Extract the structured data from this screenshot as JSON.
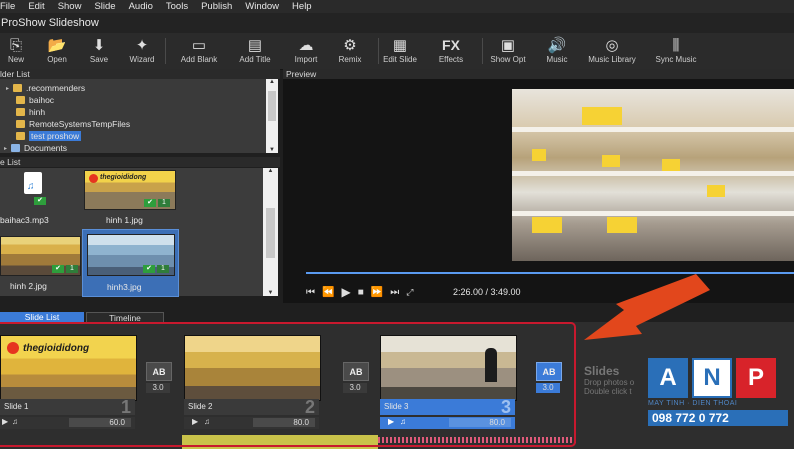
{
  "menu": [
    "File",
    "Edit",
    "Show",
    "Slide",
    "Audio",
    "Tools",
    "Publish",
    "Window",
    "Help"
  ],
  "app_title": "ProShow Slideshow",
  "toolbar": [
    {
      "label": "New",
      "icon": "new-icon"
    },
    {
      "label": "Open",
      "icon": "open-folder-icon"
    },
    {
      "label": "Save",
      "icon": "save-icon"
    },
    {
      "label": "Wizard",
      "icon": "wizard-icon"
    },
    {
      "label": "Add Blank",
      "icon": "add-blank-icon"
    },
    {
      "label": "Add Title",
      "icon": "add-title-icon"
    },
    {
      "label": "Import",
      "icon": "import-icon"
    },
    {
      "label": "Remix",
      "icon": "remix-icon"
    },
    {
      "label": "Edit Slide",
      "icon": "edit-slide-icon"
    },
    {
      "label": "Effects",
      "icon": "fx-icon"
    },
    {
      "label": "Show Opt",
      "icon": "show-options-icon"
    },
    {
      "label": "Music",
      "icon": "music-icon"
    },
    {
      "label": "Music Library",
      "icon": "music-library-icon"
    },
    {
      "label": "Sync Music",
      "icon": "sync-music-icon"
    }
  ],
  "fx_glyph": "FX",
  "folder_list": {
    "header": "lder List",
    "items": [
      ".recommenders",
      "baihoc",
      "hinh",
      "RemoteSystemsTempFiles",
      "test proshow"
    ],
    "selected_index": 4,
    "documents": "Documents"
  },
  "file_list": {
    "header": "e List",
    "files": [
      {
        "name": "baihac3.mp3"
      },
      {
        "name": "hinh 1.jpg"
      },
      {
        "name": "hinh 2.jpg"
      },
      {
        "name": "hinh3.jpg"
      }
    ],
    "check_count": "1",
    "brand_text": "thegioididong"
  },
  "preview": {
    "header": "Preview",
    "time": "2:26.00 / 3:49.00",
    "progress": 1.0
  },
  "tabs": {
    "slide_list": "Slide List",
    "timeline": "Timeline"
  },
  "slides": [
    {
      "name": "Slide 1",
      "num": "1",
      "duration": "60.0"
    },
    {
      "name": "Slide 2",
      "num": "2",
      "duration": "80.0"
    },
    {
      "name": "Slide 3",
      "num": "3",
      "duration": "80.0"
    }
  ],
  "transitions": [
    "3.0",
    "3.0",
    "3.0"
  ],
  "transition_glyph": "AB",
  "slides_placeholder": {
    "title": "Slides",
    "line1": "Drop photos o",
    "line2": "Double click t"
  },
  "watermark": {
    "letters": [
      "A",
      "N",
      "P"
    ],
    "tagline": "MAY TINH · DIEN THOAI",
    "phone": "098 772 0 772"
  },
  "colors": {
    "accent": "#3b7bd8",
    "arrow": "#e2471c",
    "highlight_border": "#c8192e",
    "anp_blue": "#2a6fb8",
    "anp_red": "#d8232a"
  }
}
